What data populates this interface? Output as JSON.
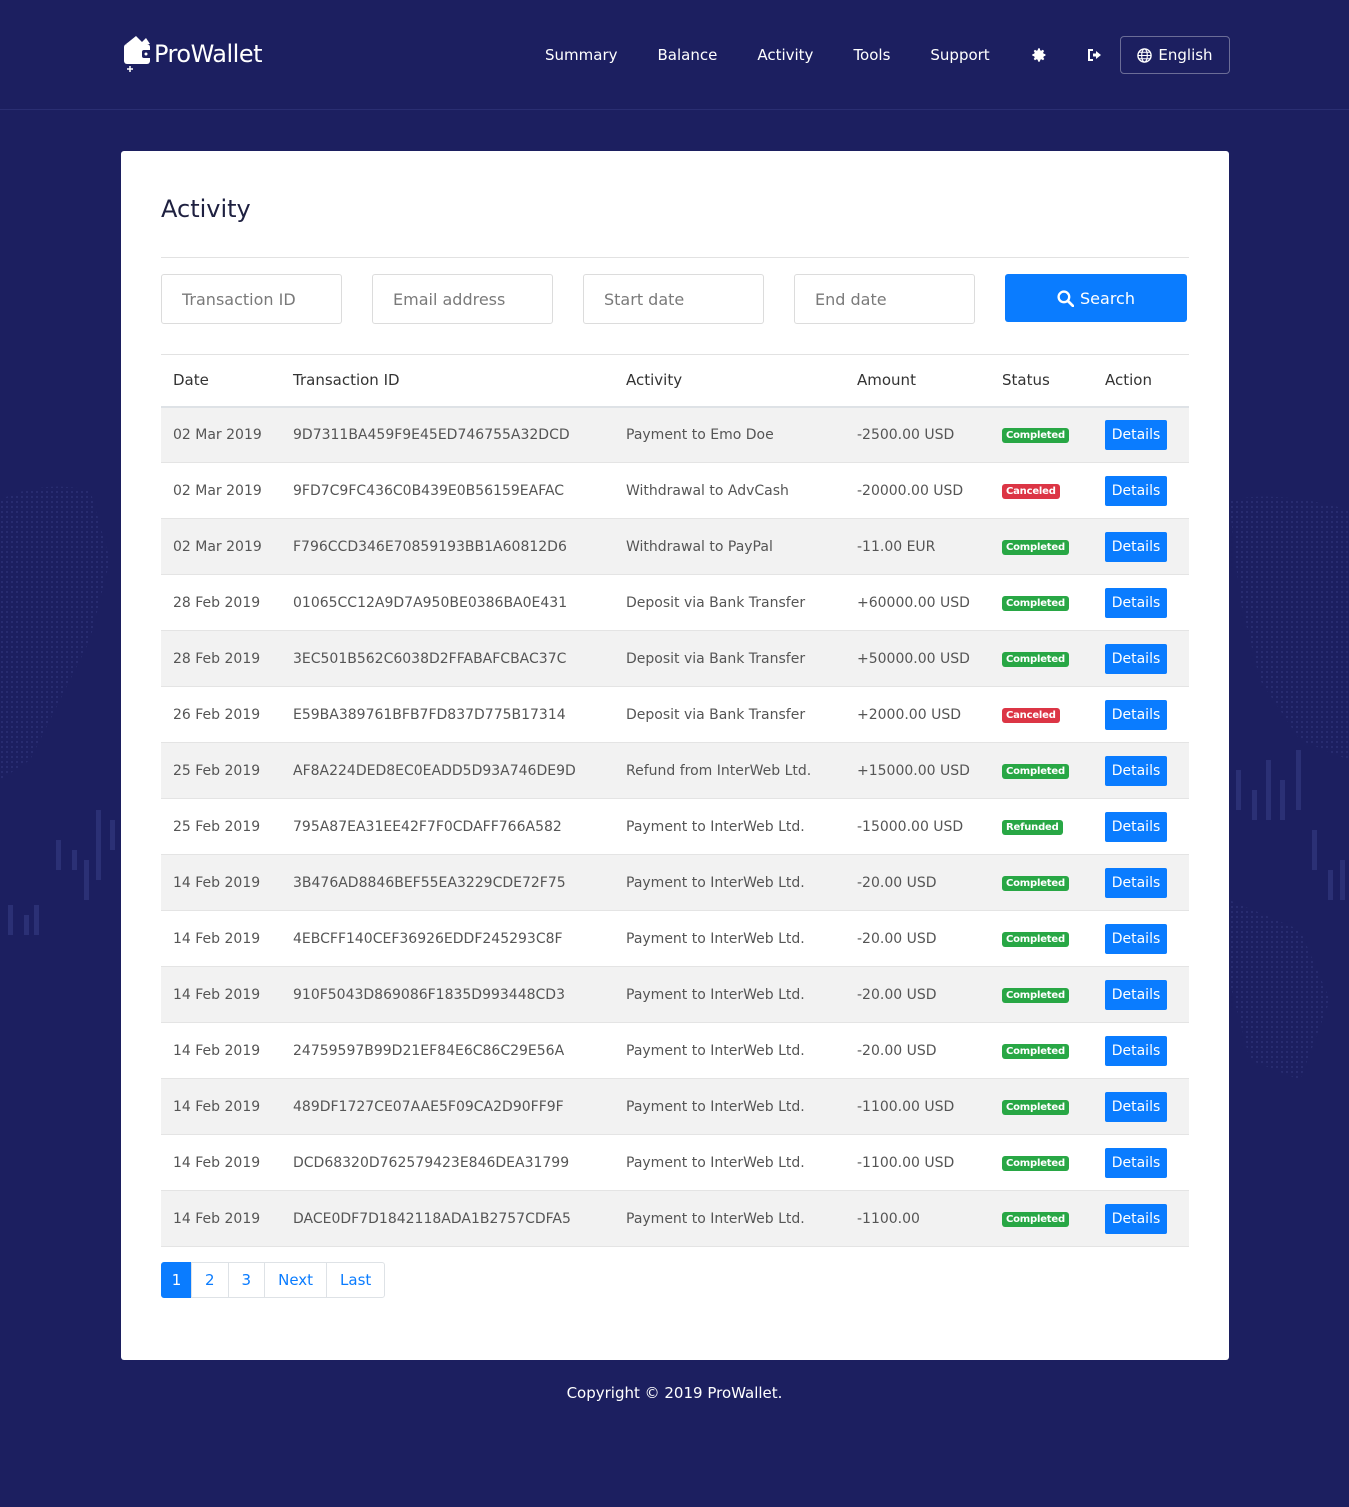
{
  "brand": {
    "name": "ProWallet"
  },
  "nav": {
    "items": [
      "Summary",
      "Balance",
      "Activity",
      "Tools",
      "Support"
    ],
    "language": "English"
  },
  "page": {
    "title": "Activity",
    "filters": {
      "transaction_id_placeholder": "Transaction ID",
      "email_placeholder": "Email address",
      "start_date_placeholder": "Start date",
      "end_date_placeholder": "End date",
      "search_label": "Search"
    },
    "table": {
      "headers": [
        "Date",
        "Transaction ID",
        "Activity",
        "Amount",
        "Status",
        "Action"
      ],
      "action_label": "Details",
      "rows": [
        {
          "date": "02 Mar 2019",
          "id": "9D7311BA459F9E45ED746755A32DCD",
          "activity": "Payment to Emo Doe",
          "amount": "-2500.00 USD",
          "status": "Completed"
        },
        {
          "date": "02 Mar 2019",
          "id": "9FD7C9FC436C0B439E0B56159EAFAC",
          "activity": "Withdrawal to AdvCash",
          "amount": "-20000.00 USD",
          "status": "Canceled"
        },
        {
          "date": "02 Mar 2019",
          "id": "F796CCD346E70859193BB1A60812D6",
          "activity": "Withdrawal to PayPal",
          "amount": "-11.00 EUR",
          "status": "Completed"
        },
        {
          "date": "28 Feb 2019",
          "id": "01065CC12A9D7A950BE0386BA0E431",
          "activity": "Deposit via Bank Transfer",
          "amount": "+60000.00 USD",
          "status": "Completed"
        },
        {
          "date": "28 Feb 2019",
          "id": "3EC501B562C6038D2FFABAFCBAC37C",
          "activity": "Deposit via Bank Transfer",
          "amount": "+50000.00 USD",
          "status": "Completed"
        },
        {
          "date": "26 Feb 2019",
          "id": "E59BA389761BFB7FD837D775B17314",
          "activity": "Deposit via Bank Transfer",
          "amount": "+2000.00 USD",
          "status": "Canceled"
        },
        {
          "date": "25 Feb 2019",
          "id": "AF8A224DED8EC0EADD5D93A746DE9D",
          "activity": "Refund from InterWeb Ltd.",
          "amount": "+15000.00 USD",
          "status": "Completed"
        },
        {
          "date": "25 Feb 2019",
          "id": "795A87EA31EE42F7F0CDAFF766A582",
          "activity": "Payment to InterWeb Ltd.",
          "amount": "-15000.00 USD",
          "status": "Refunded"
        },
        {
          "date": "14 Feb 2019",
          "id": "3B476AD8846BEF55EA3229CDE72F75",
          "activity": "Payment to InterWeb Ltd.",
          "amount": "-20.00 USD",
          "status": "Completed"
        },
        {
          "date": "14 Feb 2019",
          "id": "4EBCFF140CEF36926EDDF245293C8F",
          "activity": "Payment to InterWeb Ltd.",
          "amount": "-20.00 USD",
          "status": "Completed"
        },
        {
          "date": "14 Feb 2019",
          "id": "910F5043D869086F1835D993448CD3",
          "activity": "Payment to InterWeb Ltd.",
          "amount": "-20.00 USD",
          "status": "Completed"
        },
        {
          "date": "14 Feb 2019",
          "id": "24759597B99D21EF84E6C86C29E56A",
          "activity": "Payment to InterWeb Ltd.",
          "amount": "-20.00 USD",
          "status": "Completed"
        },
        {
          "date": "14 Feb 2019",
          "id": "489DF1727CE07AAE5F09CA2D90FF9F",
          "activity": "Payment to InterWeb Ltd.",
          "amount": "-1100.00 USD",
          "status": "Completed"
        },
        {
          "date": "14 Feb 2019",
          "id": "DCD68320D762579423E846DEA31799",
          "activity": "Payment to InterWeb Ltd.",
          "amount": "-1100.00 USD",
          "status": "Completed"
        },
        {
          "date": "14 Feb 2019",
          "id": "DACE0DF7D1842118ADA1B2757CDFA5",
          "activity": "Payment to InterWeb Ltd.",
          "amount": "-1100.00",
          "status": "Completed"
        }
      ]
    },
    "pagination": [
      "1",
      "2",
      "3",
      "Next",
      "Last"
    ],
    "current_page": "1"
  },
  "footer": {
    "copyright": "Copyright © 2019 ProWallet."
  },
  "icons": {
    "settings": "gear-icon",
    "logout": "sign-out-icon",
    "language": "globe-icon",
    "search": "search-icon",
    "logo": "wallet-icon"
  },
  "colors": {
    "background": "#1c1f60",
    "accent": "#0a7cff",
    "completed": "#28a745",
    "canceled": "#dc3545",
    "refunded": "#28a745"
  }
}
